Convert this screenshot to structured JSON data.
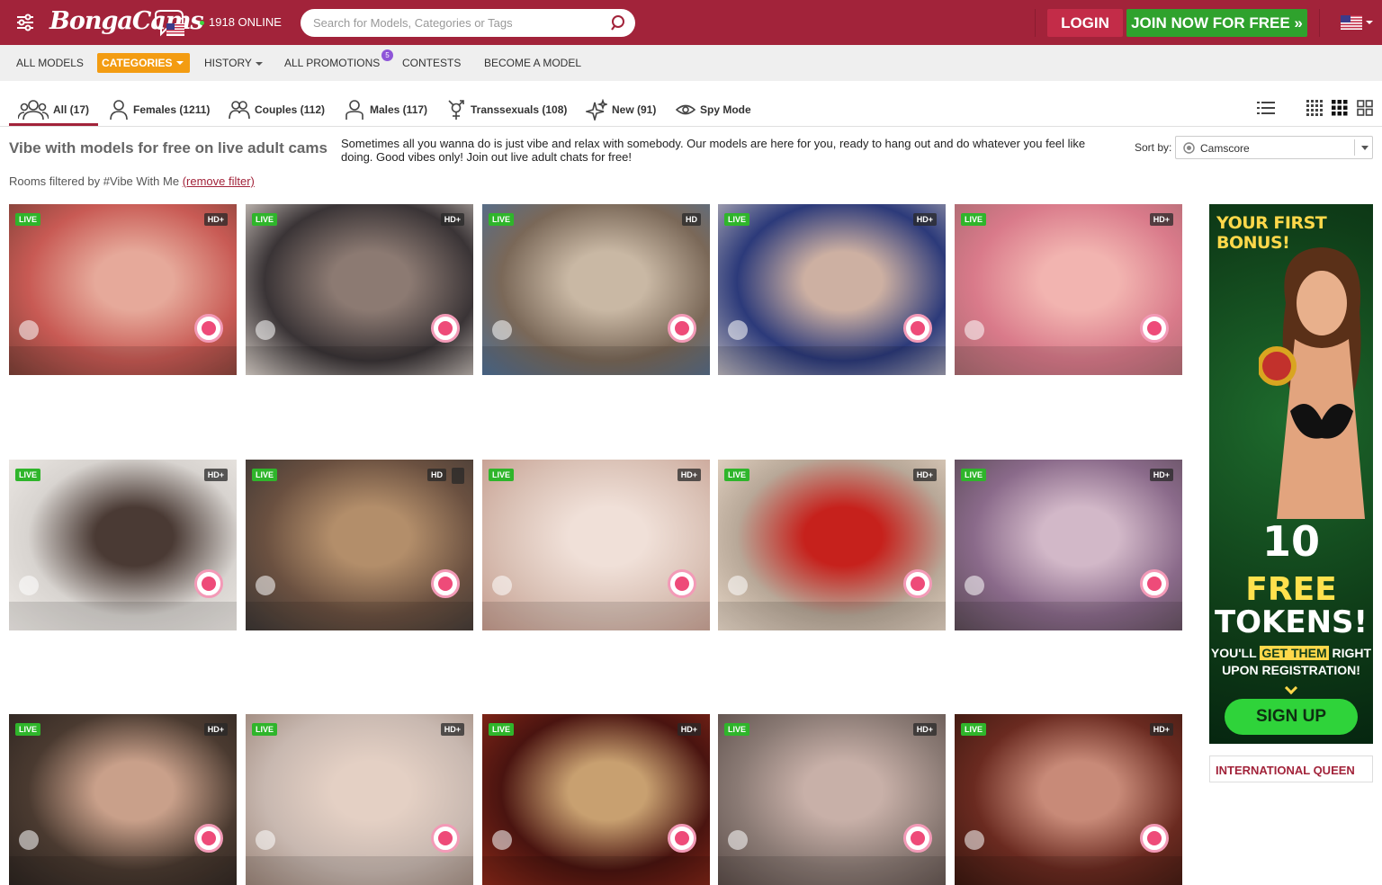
{
  "header": {
    "logo_text": "BongaCams",
    "online_count": "1918 ONLINE",
    "search_placeholder": "Search for Models, Categories or Tags",
    "login_label": "LOGIN",
    "join_label": "JOIN NOW FOR FREE »"
  },
  "subnav": {
    "all_models": "ALL MODELS",
    "categories": "CATEGORIES",
    "history": "HISTORY",
    "promotions": "ALL PROMOTIONS",
    "promotions_badge": "5",
    "contests": "CONTESTS",
    "become_model": "BECOME A MODEL"
  },
  "tabs": [
    {
      "label": "All (17)",
      "icon": "group-icon"
    },
    {
      "label": "Females (1211)",
      "icon": "female-icon"
    },
    {
      "label": "Couples (112)",
      "icon": "couple-icon"
    },
    {
      "label": "Males (117)",
      "icon": "male-icon"
    },
    {
      "label": "Transsexuals (108)",
      "icon": "trans-icon"
    },
    {
      "label": "New (91)",
      "icon": "sparkle-icon"
    },
    {
      "label": "Spy Mode",
      "icon": "eye-icon"
    }
  ],
  "page": {
    "title": "Vibe with models for free on live adult cams",
    "description": "Sometimes all you wanna do is just vibe and relax with somebody. Our models are here for you, ready to hang out and do whatever you feel like doing. Good vibes only! Join out live adult chats for free!",
    "sort_label": "Sort by:",
    "sort_value": "Camscore",
    "filter_text": "Rooms filtered by #Vibe With Me",
    "remove_filter": "(remove filter)"
  },
  "cards": [
    {
      "live": "LIVE",
      "quality": "HD+",
      "colors": [
        "#c85a54",
        "#e6a99a",
        "#7a3f36"
      ]
    },
    {
      "live": "LIVE",
      "quality": "HD+",
      "colors": [
        "#3a3436",
        "#8c7a72",
        "#d8cfc8"
      ]
    },
    {
      "live": "LIVE",
      "quality": "HD",
      "colors": [
        "#7a6858",
        "#c9b8a4",
        "#4f6f94"
      ]
    },
    {
      "live": "LIVE",
      "quality": "HD+",
      "colors": [
        "#2c3a7a",
        "#cdb0a2",
        "#b9b4ba"
      ]
    },
    {
      "live": "LIVE",
      "quality": "HD+",
      "colors": [
        "#d97a8a",
        "#f2b4b0",
        "#a86a70"
      ]
    },
    {
      "live": "LIVE",
      "quality": "HD+",
      "colors": [
        "#d8d4d0",
        "#4a3a34",
        "#f0ece8"
      ]
    },
    {
      "live": "LIVE",
      "quality": "HD",
      "mobile": true,
      "colors": [
        "#6a5040",
        "#b38e6a",
        "#3b3634"
      ]
    },
    {
      "live": "LIVE",
      "quality": "HD+",
      "colors": [
        "#d9c0b4",
        "#f0e0d8",
        "#c49a8c"
      ]
    },
    {
      "live": "LIVE",
      "quality": "HD+",
      "colors": [
        "#b8a898",
        "#c6211c",
        "#e8d8c8"
      ]
    },
    {
      "live": "LIVE",
      "quality": "HD+",
      "colors": [
        "#8a6a8a",
        "#d2b8c8",
        "#5a4a55"
      ]
    },
    {
      "live": "LIVE",
      "quality": "HD+",
      "colors": [
        "#4a3a30",
        "#c9a08a",
        "#2c2420"
      ]
    },
    {
      "live": "LIVE",
      "quality": "HD+",
      "colors": [
        "#c8b8b0",
        "#e4d0c4",
        "#9a8478"
      ]
    },
    {
      "live": "LIVE",
      "quality": "HD+",
      "colors": [
        "#4a1410",
        "#c8a070",
        "#8a2818"
      ]
    },
    {
      "live": "LIVE",
      "quality": "HD+",
      "colors": [
        "#8a7a74",
        "#c8b0a8",
        "#5a4c48"
      ]
    },
    {
      "live": "LIVE",
      "quality": "HD+",
      "colors": [
        "#6a2a20",
        "#c88a78",
        "#3a1810"
      ]
    }
  ],
  "ad": {
    "headline": "YOUR FIRST BONUS!",
    "big_number": "10",
    "big_free": "FREE",
    "big_tokens": "TOKENS!",
    "line1_a": "YOU'LL",
    "line1_hl": "GET THEM",
    "line1_b": "RIGHT",
    "line2": "UPON REGISTRATION!",
    "signup": "SIGN UP",
    "bottom_title": "INTERNATIONAL QUEEN"
  },
  "colors": {
    "brand": "#a2233a",
    "join": "#2fa22d",
    "categories": "#f39c12",
    "live": "#2fb52b"
  }
}
